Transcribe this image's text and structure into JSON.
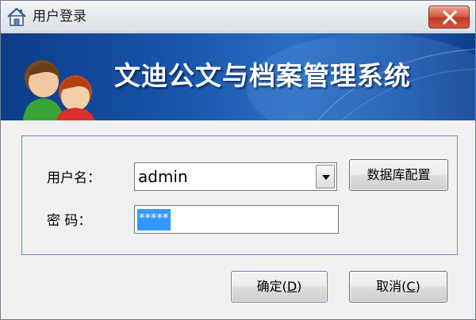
{
  "window": {
    "title": "用户登录",
    "close_icon": "close-icon",
    "app_icon": "house-icon"
  },
  "banner": {
    "title": "文迪公文与档案管理系统",
    "illustration_icon": "users-icon"
  },
  "form": {
    "username_label": "用户名：",
    "username_value": "admin",
    "password_label": "密 码：",
    "password_value": "*****",
    "db_config_label": "数据库配置"
  },
  "buttons": {
    "ok_prefix": "确定(",
    "ok_key": "D",
    "ok_suffix": ")",
    "cancel_prefix": "取消(",
    "cancel_key": "C",
    "cancel_suffix": ")"
  },
  "colors": {
    "banner_dark": "#0d3c88",
    "banner_light": "#2a6fc4",
    "panel_border": "#6a8fc8",
    "selection": "#3399ff",
    "close_red": "#c23a22"
  }
}
